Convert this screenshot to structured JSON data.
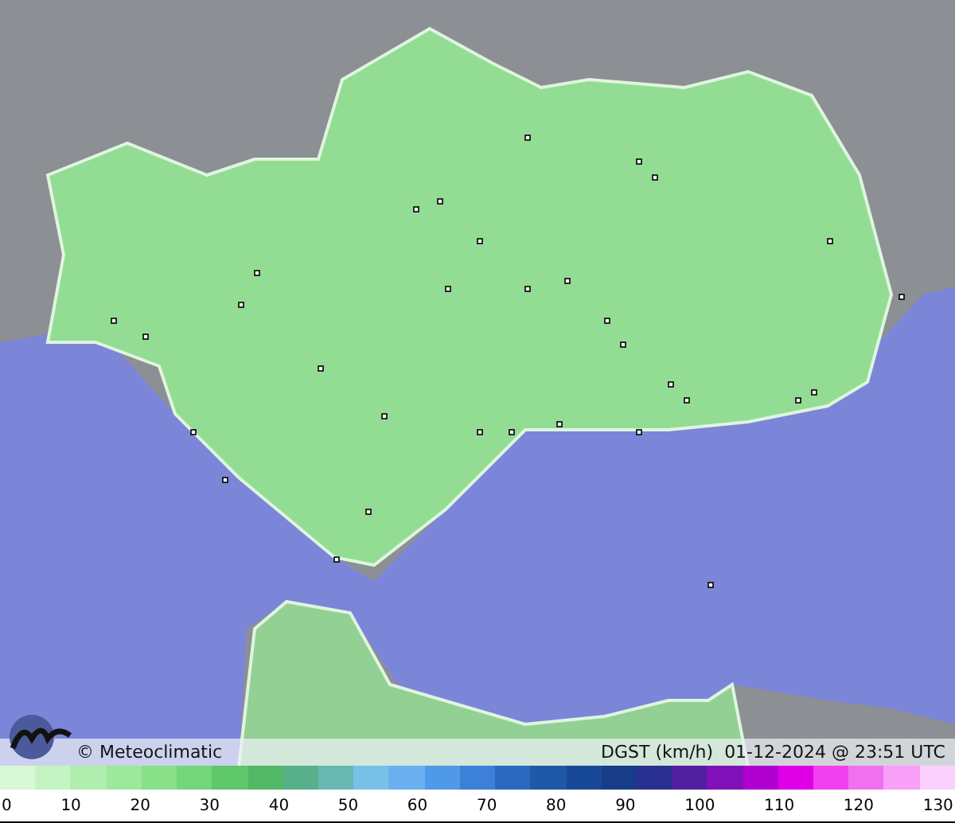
{
  "map": {
    "credit": "© Meteoclimatic",
    "caption": "DGST (km/h)  01-12-2024 @ 23:51 UTC"
  },
  "legend": {
    "swatches": [
      {
        "color": "#d8f8d8"
      },
      {
        "color": "#c4f4c4"
      },
      {
        "color": "#b0eeb0"
      },
      {
        "color": "#9ce89c"
      },
      {
        "color": "#88e088"
      },
      {
        "color": "#74d67a"
      },
      {
        "color": "#5ec86a"
      },
      {
        "color": "#52b865"
      },
      {
        "color": "#58b08a"
      },
      {
        "color": "#68b8b0"
      },
      {
        "color": "#78c0e8"
      },
      {
        "color": "#6ab0f0"
      },
      {
        "color": "#5098e8"
      },
      {
        "color": "#3c80d8"
      },
      {
        "color": "#2c68c0"
      },
      {
        "color": "#2058a8"
      },
      {
        "color": "#184898"
      },
      {
        "color": "#183c88"
      },
      {
        "color": "#2a3090"
      },
      {
        "color": "#5020a0"
      },
      {
        "color": "#8010b8"
      },
      {
        "color": "#b000d0"
      },
      {
        "color": "#e000e8"
      },
      {
        "color": "#f040f0"
      },
      {
        "color": "#f070f0"
      },
      {
        "color": "#f8a0f8"
      },
      {
        "color": "#fcd0fc"
      }
    ],
    "ticks": [
      "0",
      "10",
      "20",
      "30",
      "40",
      "50",
      "60",
      "70",
      "80",
      "90",
      "100",
      "110",
      "120",
      "130"
    ]
  }
}
